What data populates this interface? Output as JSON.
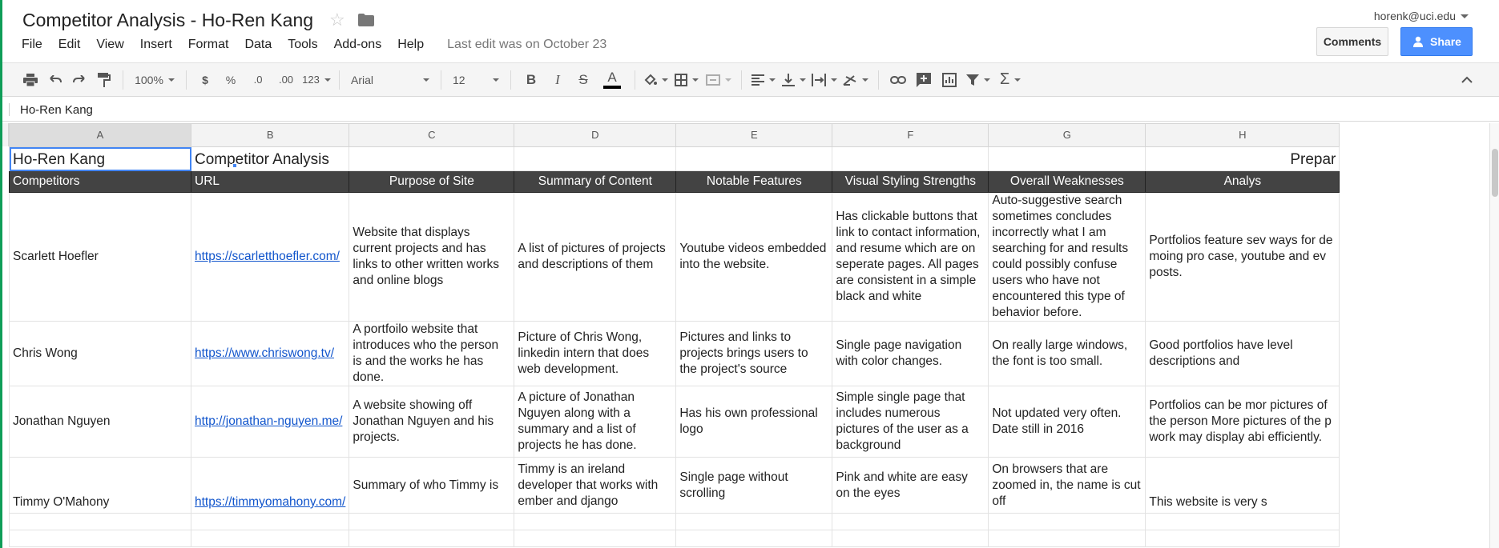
{
  "doc": {
    "title": "Competitor Analysis - Ho-Ren Kang",
    "user": "horenk@uci.edu",
    "last_edit": "Last edit was on October 23"
  },
  "menu": [
    "File",
    "Edit",
    "View",
    "Insert",
    "Format",
    "Data",
    "Tools",
    "Add-ons",
    "Help"
  ],
  "buttons": {
    "comments": "Comments",
    "share": "Share"
  },
  "toolbar": {
    "zoom": "100%",
    "currency": "$",
    "percent": "%",
    "dec_decrease": ".0",
    "dec_increase": ".00",
    "more_formats": "123",
    "font": "Arial",
    "font_size": "12",
    "bold": "B",
    "italic": "I",
    "strike": "S",
    "text_color": "A",
    "text_color_value": "#000000"
  },
  "formula_bar": {
    "value": "Ho-Ren Kang"
  },
  "columns": [
    "A",
    "B",
    "C",
    "D",
    "E",
    "F",
    "G",
    "H"
  ],
  "sheet": {
    "title_row": {
      "a": "Ho-Ren Kang",
      "b": "Competitor Analysis",
      "h": "Prepar"
    },
    "headers": [
      "Competitors",
      "URL",
      "Purpose of Site",
      "Summary of Content",
      "Notable Features",
      "Visual Styling Strengths",
      "Overall Weaknesses",
      "Analys"
    ],
    "rows": [
      {
        "name": "Scarlett Hoefler",
        "url": "https://scarletthoefler.com/",
        "purpose": "Website that displays current projects and has links to other written works and online blogs",
        "summary": "A list of pictures of projects and descriptions of them",
        "features": "Youtube videos embedded into the website.",
        "styling": "Has clickable buttons that link to contact information, and resume which are on seperate pages. All pages are consistent in a simple black and white",
        "weaknesses": "Auto-suggestive search sometimes concludes incorrectly what I am searching for and results could possibly confuse users who have not encountered this type of behavior before.",
        "analysis": "Portfolios feature sev ways for demoing pro case, youtube and ev posts."
      },
      {
        "name": "Chris Wong",
        "url": "https://www.chriswong.tv/",
        "purpose": " A portfoilo website that introduces who the person is and the works he has done.",
        "summary": "Picture of Chris Wong, linkedin intern that does web development.",
        "features": "Pictures and links to projects brings users to the project's source",
        "styling": "Single page navigation with color changes.",
        "weaknesses": "On really large windows, the font is too small.",
        "analysis": "Good portfolios have level descriptions and"
      },
      {
        "name": "Jonathan Nguyen",
        "url": "http://jonathan-nguyen.me/",
        "purpose": "A website showing off Jonathan Nguyen and his projects.",
        "summary": "A picture of Jonathan Nguyen along with a summary and a list of projects he has done.",
        "features": "Has his own professional logo",
        "styling": "Simple single page that includes numerous pictures of the user as a background",
        "weaknesses": "Not updated very often. Date still in 2016",
        "analysis": "Portfolios can be mor pictures of the person More pictures of the p work may display abi efficiently."
      },
      {
        "name": "Timmy O'Mahony",
        "url": "https://timmyomahony.com/",
        "purpose": "Summary of who Timmy is",
        "summary": "Timmy is an ireland developer that works with ember and django",
        "features": "Single page without scrolling",
        "styling": "Pink and white are easy on the eyes",
        "weaknesses": "On browsers that are zoomed in, the name is cut off",
        "analysis": "This website is very s"
      }
    ]
  },
  "colors": {
    "header_bg": "#434343",
    "share_bg": "#4d90fe",
    "link": "#1155cc",
    "selection": "#4285f4",
    "sheets_green": "#0f9d58"
  }
}
